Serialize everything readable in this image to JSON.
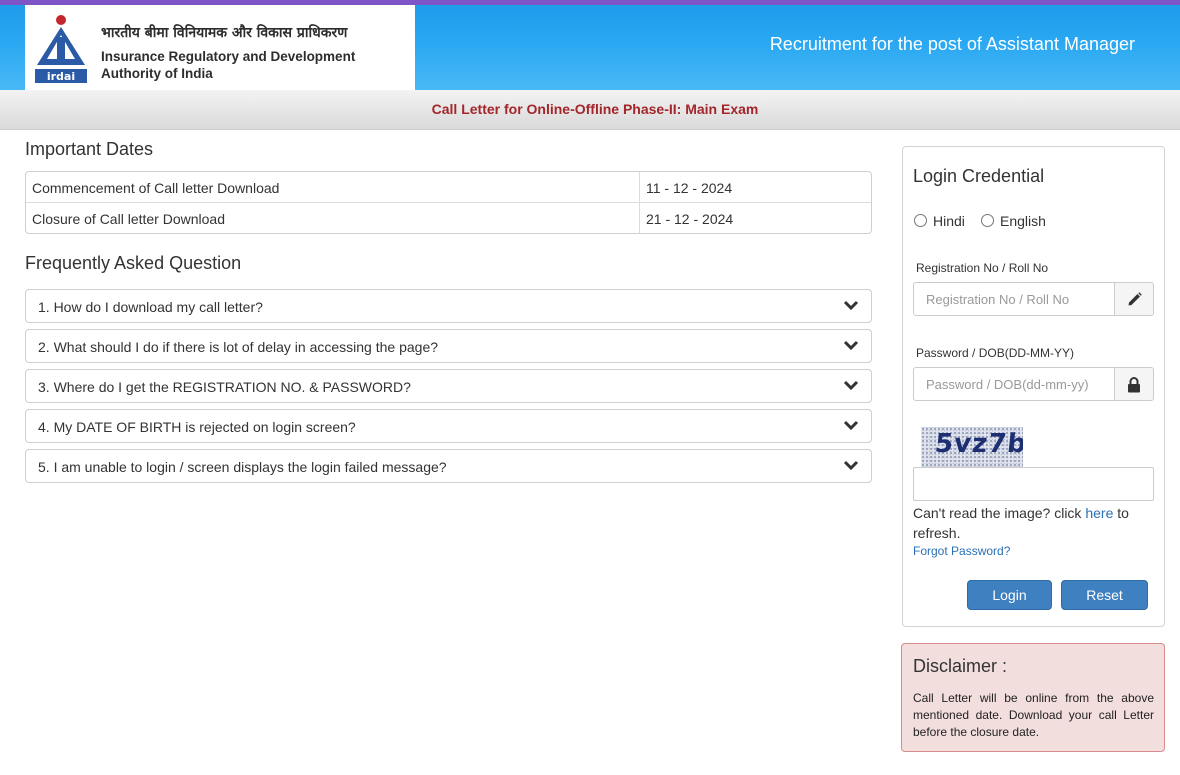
{
  "header": {
    "org_hindi": "भारतीय बीमा विनियामक और विकास प्राधिकरण",
    "org_english_line1": "Insurance Regulatory and Development",
    "org_english_line2": "Authority of India",
    "logo_text": "irdai",
    "title": "Recruitment for the post of Assistant Manager"
  },
  "subheader": {
    "text": "Call Letter for Online-Offline Phase-II: Main Exam"
  },
  "important_dates": {
    "heading": "Important Dates",
    "rows": [
      {
        "label": "Commencement of Call letter Download",
        "value": "11 - 12 - 2024"
      },
      {
        "label": "Closure of Call letter Download",
        "value": "21 - 12 - 2024"
      }
    ]
  },
  "faq": {
    "heading": "Frequently Asked Question",
    "items": [
      "1. How do I download my call letter?",
      "2. What should I do if there is lot of delay in accessing the page?",
      "3. Where do I get the REGISTRATION NO. & PASSWORD?",
      "4. My DATE OF BIRTH is rejected on login screen?",
      "5. I am unable to login / screen displays the login failed message?"
    ]
  },
  "login": {
    "title": "Login Credential",
    "languages": [
      "Hindi",
      "English"
    ],
    "reg_label": "Registration No / Roll No",
    "reg_placeholder": "Registration No / Roll No",
    "reg_value": "",
    "pwd_label": "Password / DOB(DD-MM-YY)",
    "pwd_placeholder": "Password / DOB(dd-mm-yy)",
    "pwd_value": "",
    "captcha_text": "5vz7b",
    "captcha_value": "",
    "refresh_prefix": "Can't read the image? click ",
    "refresh_link": "here",
    "refresh_suffix": " to refresh.",
    "forgot": "Forgot Password?",
    "login_button": "Login",
    "reset_button": "Reset"
  },
  "disclaimer": {
    "title": "Disclaimer :",
    "text": "Call Letter will be online from the above mentioned date. Download your call Letter before the closure date."
  },
  "colors": {
    "banner_blue": "#2aa8f2",
    "subheader_red": "#a3262b",
    "button_blue": "#3f80c1",
    "link_blue": "#2a6fb4",
    "disclaimer_bg": "#f3dede",
    "top_line_purple": "#7d55c7"
  },
  "icons": {
    "faq_toggle": "chevron-down-icon",
    "reg_field": "pencil-icon",
    "pwd_field": "lock-icon",
    "logo": "irdai-logo-icon"
  }
}
